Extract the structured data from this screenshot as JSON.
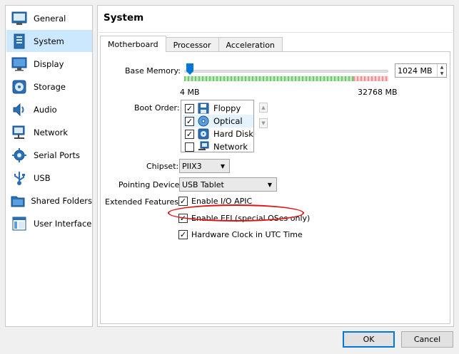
{
  "sidebar": {
    "items": [
      {
        "label": "General",
        "icon": "general-icon"
      },
      {
        "label": "System",
        "icon": "system-icon"
      },
      {
        "label": "Display",
        "icon": "display-icon"
      },
      {
        "label": "Storage",
        "icon": "storage-icon"
      },
      {
        "label": "Audio",
        "icon": "audio-icon"
      },
      {
        "label": "Network",
        "icon": "network-icon"
      },
      {
        "label": "Serial Ports",
        "icon": "serial-ports-icon"
      },
      {
        "label": "USB",
        "icon": "usb-icon"
      },
      {
        "label": "Shared Folders",
        "icon": "shared-folders-icon"
      },
      {
        "label": "User Interface",
        "icon": "user-interface-icon"
      }
    ],
    "selected": "System"
  },
  "panel": {
    "title": "System",
    "tabs": [
      "Motherboard",
      "Processor",
      "Acceleration"
    ],
    "active_tab": "Motherboard"
  },
  "motherboard": {
    "base_memory_label": "Base Memory:",
    "base_memory_value": "1024 MB",
    "memory_min_label": "4 MB",
    "memory_max_label": "32768 MB",
    "boot_order_label": "Boot Order:",
    "boot_devices": [
      {
        "label": "Floppy",
        "checked": true
      },
      {
        "label": "Optical",
        "checked": true
      },
      {
        "label": "Hard Disk",
        "checked": true
      },
      {
        "label": "Network",
        "checked": false
      }
    ],
    "chipset_label": "Chipset:",
    "chipset_value": "PIIX3",
    "pointing_label": "Pointing Device:",
    "pointing_value": "USB Tablet",
    "extended_label": "Extended Features:",
    "features": [
      {
        "label": "Enable I/O APIC",
        "checked": true
      },
      {
        "label": "Enable EFI (special OSes only)",
        "checked": true
      },
      {
        "label": "Hardware Clock in UTC Time",
        "checked": true
      }
    ]
  },
  "buttons": {
    "ok": "OK",
    "cancel": "Cancel"
  },
  "colors": {
    "selection": "#cce8ff",
    "highlight_ellipse": "#e01010",
    "default_button_border": "#0078d7"
  }
}
